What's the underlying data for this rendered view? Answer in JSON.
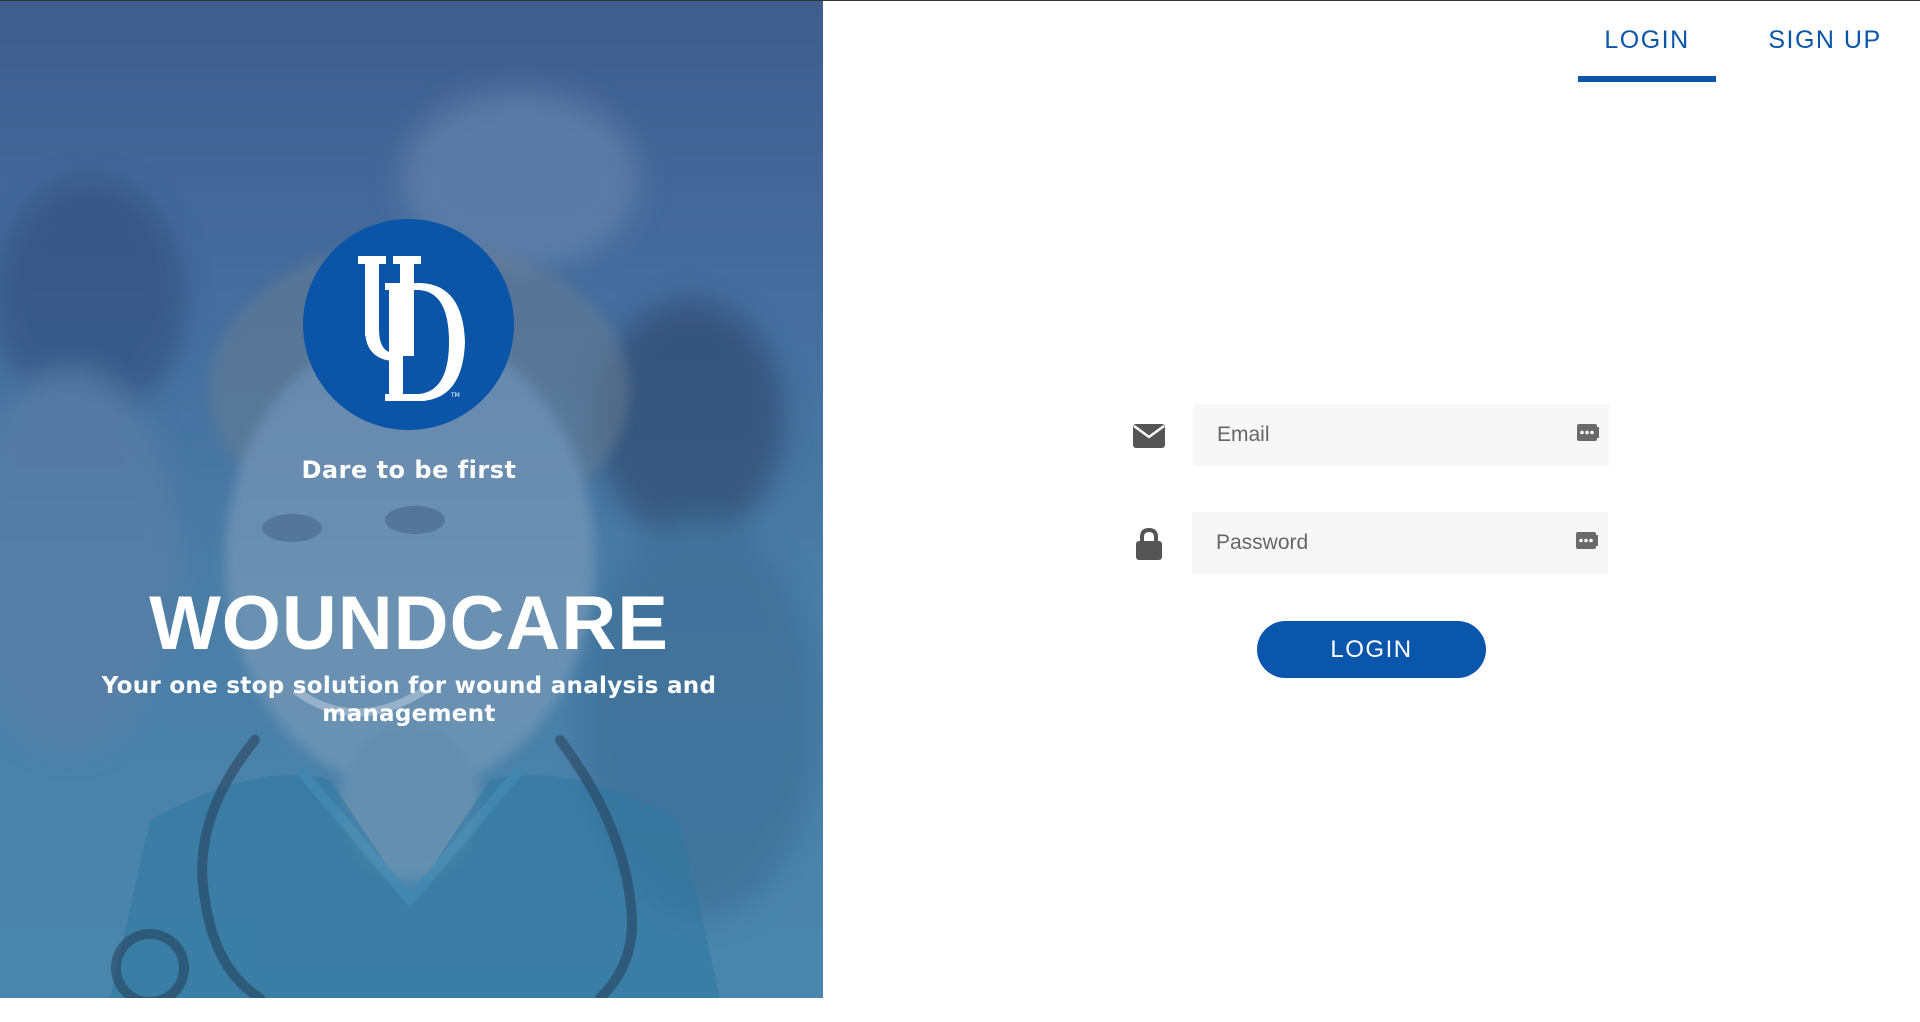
{
  "brand": {
    "logo_text": "UD",
    "logo_color": "#0a55a8",
    "tagline": "Dare to be first",
    "app_title": "WOUNDCARE",
    "app_subtitle": "Your one stop solution for wound analysis and management"
  },
  "tabs": {
    "login_label": "LOGIN",
    "signup_label": "SIGN UP",
    "active": "LOGIN"
  },
  "form": {
    "email": {
      "value": "",
      "placeholder": "Email",
      "icon": "envelope-icon"
    },
    "password": {
      "value": "",
      "placeholder": "Password",
      "icon": "lock-icon"
    },
    "autofill_icon": "password-manager-icon",
    "submit_label": "LOGIN"
  },
  "colors": {
    "accent": "#0b56a8",
    "hero_overlay": "#4a7ea7",
    "input_background": "#f7f7f7"
  }
}
